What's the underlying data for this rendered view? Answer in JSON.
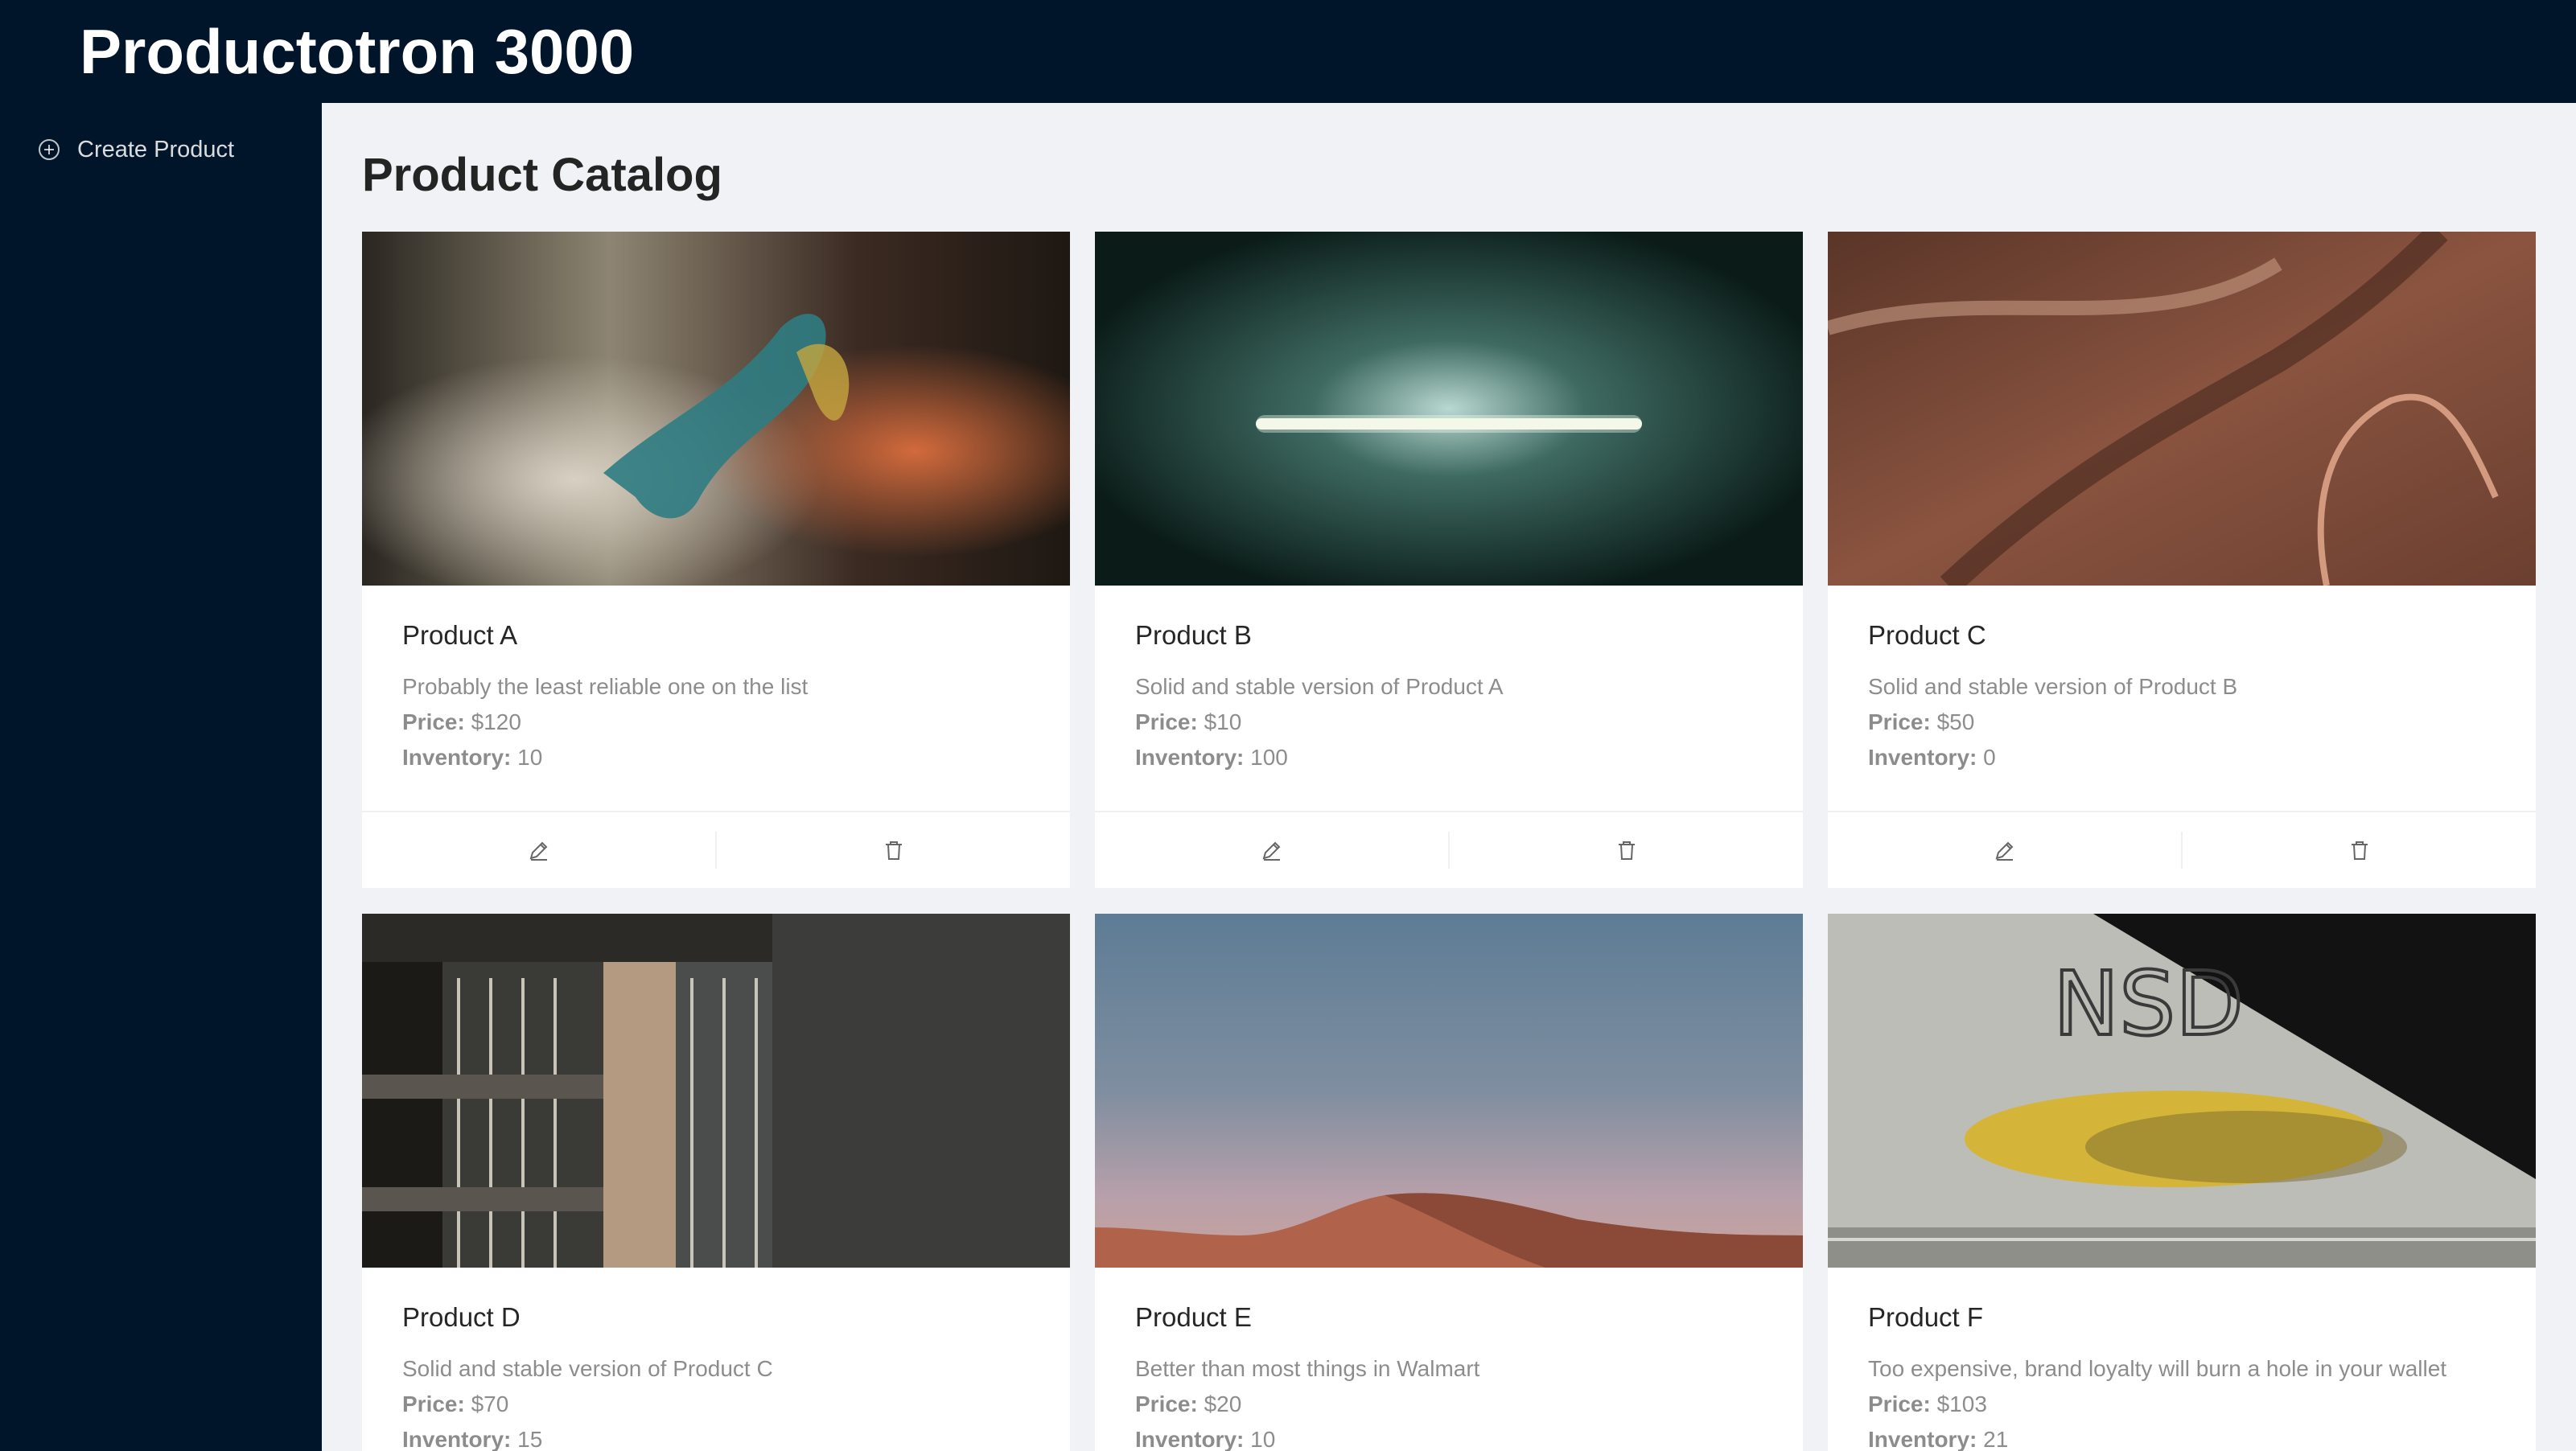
{
  "header": {
    "title": "Productotron 3000"
  },
  "sidebar": {
    "items": [
      {
        "label": "Create Product",
        "icon": "plus-circle-icon"
      }
    ]
  },
  "main": {
    "title": "Product Catalog",
    "labels": {
      "price": "Price:",
      "inventory": "Inventory:"
    },
    "actions": {
      "edit_icon": "edit-icon",
      "delete_icon": "delete-icon"
    },
    "products": [
      {
        "name": "Product A",
        "description": "Probably the least reliable one on the list",
        "price": "$120",
        "inventory": "10",
        "image": "abstract colorful paint explosion"
      },
      {
        "name": "Product B",
        "description": "Solid and stable version of Product A",
        "price": "$10",
        "inventory": "100",
        "image": "fluorescent tube light on dark wall"
      },
      {
        "name": "Product C",
        "description": "Solid and stable version of Product B",
        "price": "$50",
        "inventory": "0",
        "image": "aerial view of red canyon road"
      },
      {
        "name": "Product D",
        "description": "Solid and stable version of Product C",
        "price": "$70",
        "inventory": "15",
        "image": "modern building facade"
      },
      {
        "name": "Product E",
        "description": "Better than most things in Walmart",
        "price": "$20",
        "inventory": "10",
        "image": "desert dune under cloudy sky"
      },
      {
        "name": "Product F",
        "description": "Too expensive, brand loyalty will burn a hole in your wallet",
        "price": "$103",
        "inventory": "21",
        "image": "blurred yellow car under concrete bridge",
        "graffiti": "NSD"
      }
    ]
  }
}
